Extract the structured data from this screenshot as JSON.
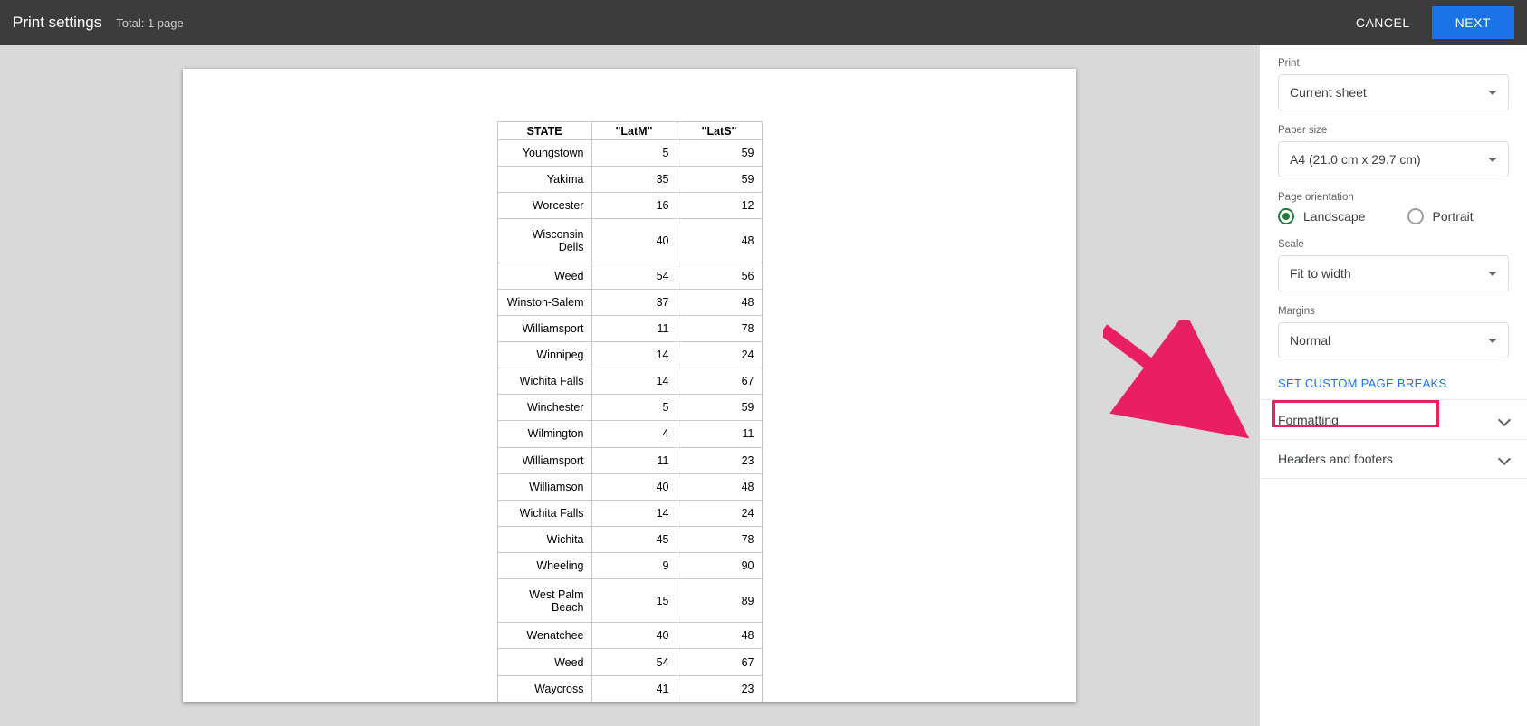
{
  "header": {
    "title": "Print settings",
    "subtitle": "Total: 1 page",
    "cancel": "CANCEL",
    "next": "NEXT"
  },
  "sidebar": {
    "print_label": "Print",
    "print_value": "Current sheet",
    "paper_label": "Paper size",
    "paper_value": "A4 (21.0 cm x 29.7 cm)",
    "orient_label": "Page orientation",
    "orient_landscape": "Landscape",
    "orient_portrait": "Portrait",
    "scale_label": "Scale",
    "scale_value": "Fit to width",
    "margins_label": "Margins",
    "margins_value": "Normal",
    "page_breaks": "SET CUSTOM PAGE BREAKS",
    "formatting": "Formatting",
    "headers_footers": "Headers and footers"
  },
  "table": {
    "headers": {
      "state": "STATE",
      "latm": "\"LatM\"",
      "lats": "\"LatS\""
    },
    "rows": [
      {
        "state": "Youngstown",
        "latm": "5",
        "lats": "59"
      },
      {
        "state": "Yakima",
        "latm": "35",
        "lats": "59"
      },
      {
        "state": "Worcester",
        "latm": "16",
        "lats": "12"
      },
      {
        "state": "Wisconsin Dells",
        "latm": "40",
        "lats": "48"
      },
      {
        "state": "Weed",
        "latm": "54",
        "lats": "56"
      },
      {
        "state": "Winston-Salem",
        "latm": "37",
        "lats": "48"
      },
      {
        "state": "Williamsport",
        "latm": "11",
        "lats": "78"
      },
      {
        "state": "Winnipeg",
        "latm": "14",
        "lats": "24"
      },
      {
        "state": "Wichita Falls",
        "latm": "14",
        "lats": "67"
      },
      {
        "state": "Winchester",
        "latm": "5",
        "lats": "59"
      },
      {
        "state": "Wilmington",
        "latm": "4",
        "lats": "11"
      },
      {
        "state": "Williamsport",
        "latm": "11",
        "lats": "23"
      },
      {
        "state": "Williamson",
        "latm": "40",
        "lats": "48"
      },
      {
        "state": "Wichita Falls",
        "latm": "14",
        "lats": "24"
      },
      {
        "state": "Wichita",
        "latm": "45",
        "lats": "78"
      },
      {
        "state": "Wheeling",
        "latm": "9",
        "lats": "90"
      },
      {
        "state": "West Palm Beach",
        "latm": "15",
        "lats": "89"
      },
      {
        "state": "Wenatchee",
        "latm": "40",
        "lats": "48"
      },
      {
        "state": "Weed",
        "latm": "54",
        "lats": "67"
      },
      {
        "state": "Waycross",
        "latm": "41",
        "lats": "23"
      }
    ]
  }
}
